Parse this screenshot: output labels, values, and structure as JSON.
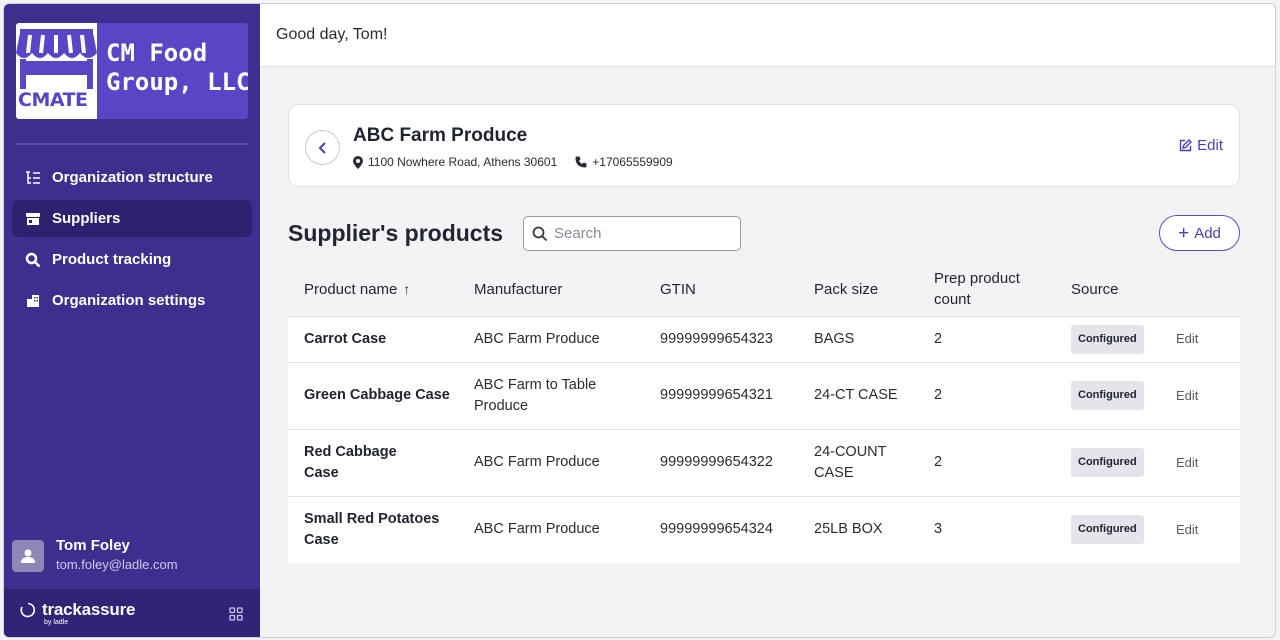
{
  "brand": {
    "logo_text": "CMATE",
    "name_line1": "CM Food",
    "name_line2": "Group, LLC"
  },
  "nav": {
    "items": [
      {
        "label": "Organization structure",
        "icon": "org-structure-icon"
      },
      {
        "label": "Suppliers",
        "icon": "store-icon",
        "active": true
      },
      {
        "label": "Product tracking",
        "icon": "search-icon"
      },
      {
        "label": "Organization settings",
        "icon": "building-icon"
      }
    ]
  },
  "user": {
    "name": "Tom Foley",
    "email": "tom.foley@ladle.com"
  },
  "footer": {
    "product": "trackassure",
    "by": "by ladle"
  },
  "header": {
    "greeting": "Good day, Tom!"
  },
  "supplier": {
    "name": "ABC Farm Produce",
    "address": "1100 Nowhere Road, Athens 30601",
    "phone": "+17065559909",
    "edit_label": "Edit"
  },
  "products": {
    "title": "Supplier's products",
    "search_placeholder": "Search",
    "add_label": "Add",
    "columns": [
      "Product name",
      "Manufacturer",
      "GTIN",
      "Pack size",
      "Prep product count",
      "Source"
    ],
    "rows": [
      {
        "name": "Carrot Case",
        "manufacturer": "ABC Farm Produce",
        "gtin": "99999999654323",
        "pack": "BAGS",
        "count": "2",
        "source": "Configured",
        "edit": "Edit"
      },
      {
        "name": "Green Cabbage Case",
        "manufacturer": "ABC Farm to Table Produce",
        "gtin": "99999999654321",
        "pack": "24-CT CASE",
        "count": "2",
        "source": "Configured",
        "edit": "Edit"
      },
      {
        "name": "Red Cabbage Case",
        "manufacturer": "ABC Farm Produce",
        "gtin": "99999999654322",
        "pack": "24-COUNT CASE",
        "count": "2",
        "source": "Configured",
        "edit": "Edit"
      },
      {
        "name": "Small Red Potatoes Case",
        "manufacturer": "ABC Farm Produce",
        "gtin": "99999999654324",
        "pack": "25LB BOX",
        "count": "3",
        "source": "Configured",
        "edit": "Edit"
      }
    ]
  },
  "colors": {
    "sidebar": "#3d2f8e",
    "sidebar_active": "#2d2270",
    "accent": "#4a3fb0",
    "brand_bg": "#5b45c7"
  }
}
